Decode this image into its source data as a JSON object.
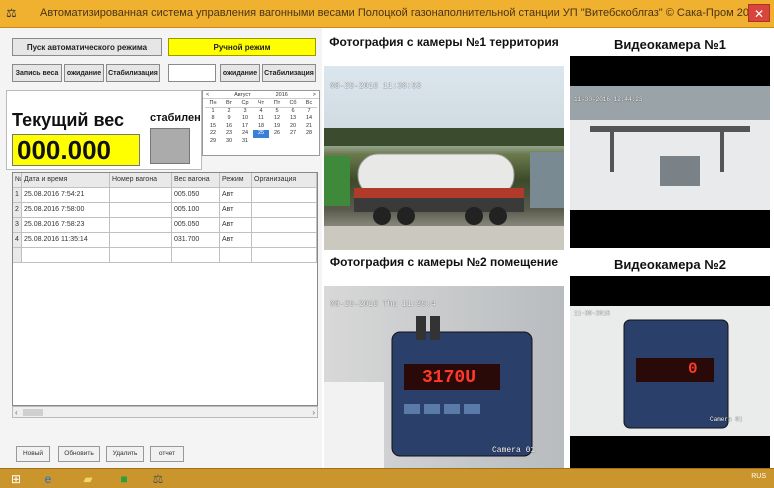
{
  "window": {
    "title": "Автоматизированная система управления вагонными весами Полоцкой газонаполнительной станции УП \"Витебскоблгаз\"  © Сака-Пром 2016",
    "close_glyph": "✕",
    "app_glyph": "⚖"
  },
  "controls": {
    "start_auto": "Пуск автоматического режима",
    "manual_mode": "Ручной режим",
    "record_weight": "Запись веса",
    "wait_1": "ожидание",
    "stabilization_1": "Стабилизация",
    "wait_2": "ожидание",
    "stabilization_2": "Стабилизация"
  },
  "weight": {
    "label": "Текущий вес",
    "value": "000.000",
    "stable_label": "стабилен"
  },
  "calendar": {
    "month": "Август",
    "year": "2016",
    "prev": "<",
    "next": ">",
    "dow": [
      "Пн",
      "Вт",
      "Ср",
      "Чт",
      "Пт",
      "Сб",
      "Вс"
    ],
    "days": [
      "1",
      "2",
      "3",
      "4",
      "5",
      "6",
      "7",
      "8",
      "9",
      "10",
      "11",
      "12",
      "13",
      "14",
      "15",
      "16",
      "17",
      "18",
      "19",
      "20",
      "21",
      "22",
      "23",
      "24",
      "25",
      "26",
      "27",
      "28",
      "29",
      "30",
      "31"
    ],
    "selected": "25"
  },
  "table": {
    "headers": [
      "№",
      "Дата и время",
      "Номер вагона",
      "Вес вагона",
      "Режим",
      "Организация"
    ],
    "rows": [
      [
        "1",
        "25.08.2016 7:54:21",
        "",
        "005.050",
        "Авт",
        ""
      ],
      [
        "2",
        "25.08.2016 7:58:00",
        "",
        "005.100",
        "Авт",
        ""
      ],
      [
        "3",
        "25.08.2016 7:58:23",
        "",
        "005.050",
        "Авт",
        ""
      ],
      [
        "4",
        "25.08.2016 11:35:14",
        "",
        "031.700",
        "Авт",
        ""
      ]
    ]
  },
  "bottom_buttons": {
    "new": "Новый",
    "refresh": "Обновить",
    "delete": "Удалить",
    "report": "отчет"
  },
  "cameras": {
    "photo1_title": "Фотография с камеры №1 территория",
    "video1_title": "Видеокамера №1",
    "photo2_title": "Фотография с камеры №2 помещение",
    "video2_title": "Видеокамера №2",
    "photo1_stamp": "08-25-2016 11:36:53",
    "video1_stamp": "11-30-2016 12:44:23",
    "photo2_stamp": "08-25-2016 Thu 11:35:4",
    "video2_stamp": "11-30-2016",
    "photo2_display": "3170U",
    "video2_display": "0",
    "photo2_camlabel": "Camera 01",
    "video2_camlabel": "Camera 01"
  },
  "taskbar": {
    "tray_text": "RUS"
  }
}
